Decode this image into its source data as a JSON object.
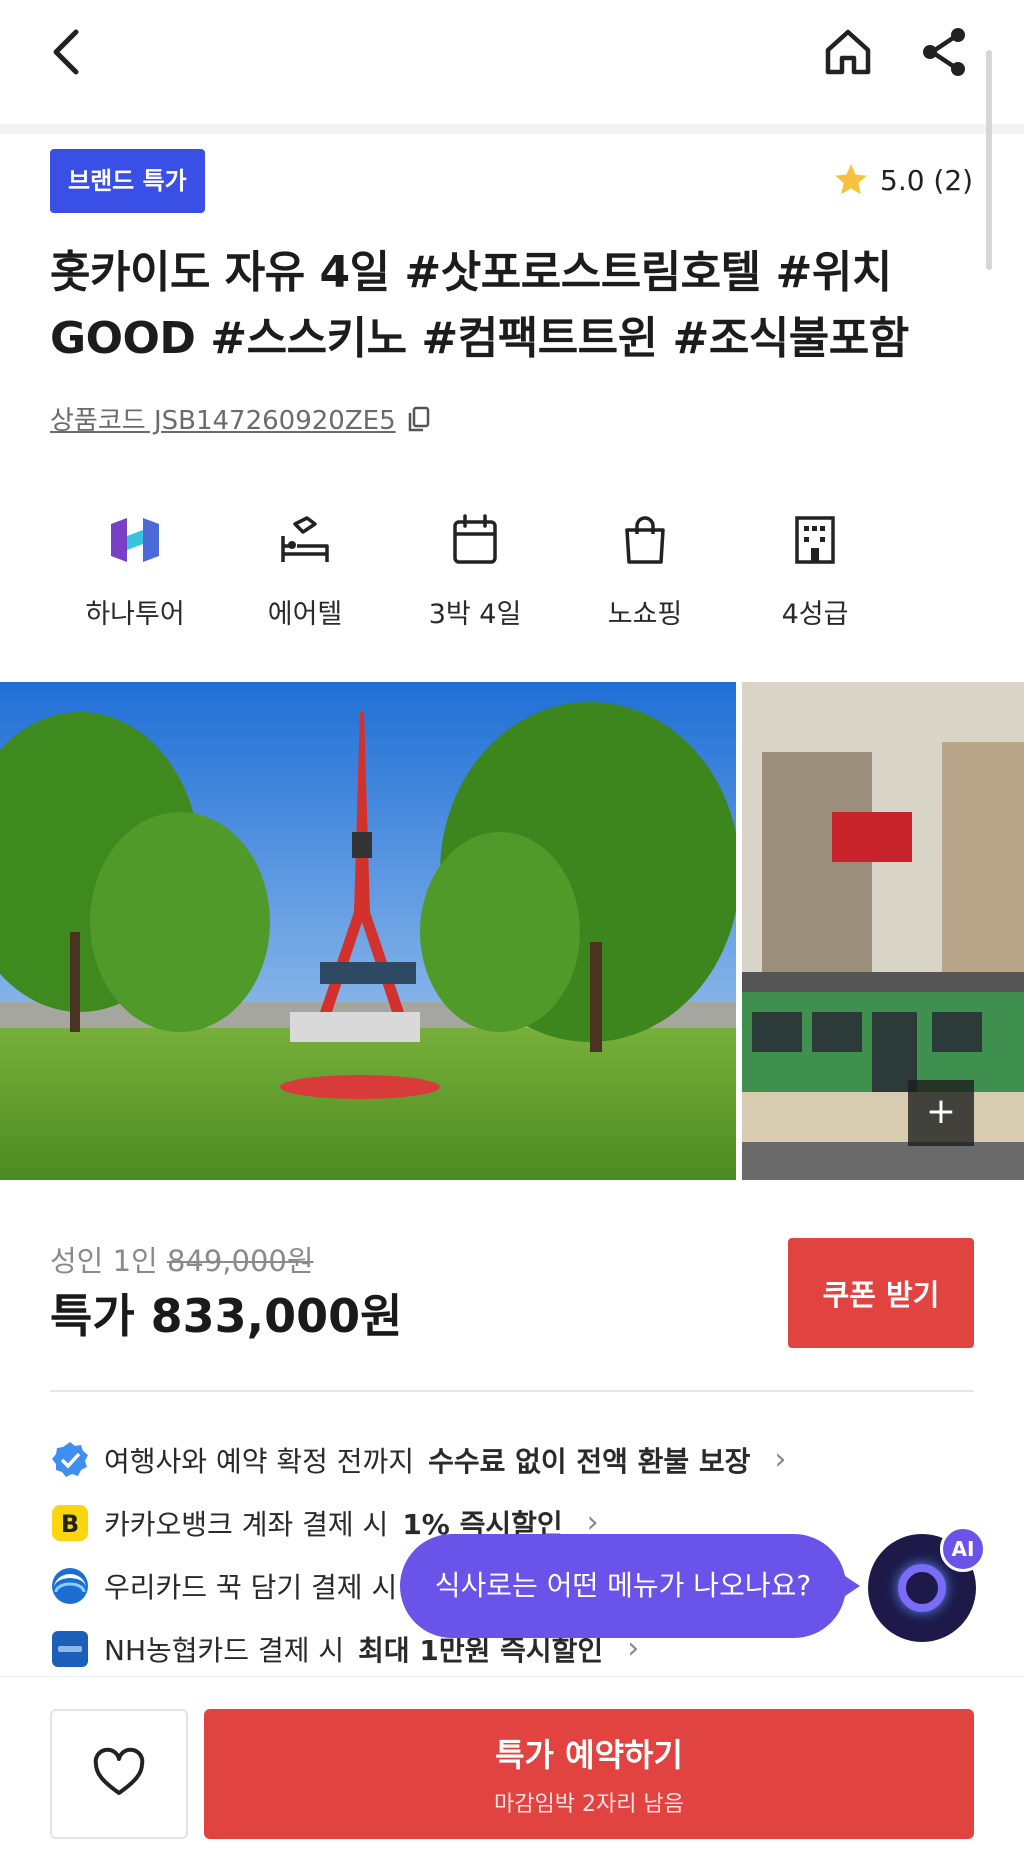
{
  "header": {
    "back_icon": "chevron-left-icon",
    "home_icon": "home-icon",
    "share_icon": "share-icon"
  },
  "product": {
    "badge": "브랜드 특가",
    "rating": "5.0 (2)",
    "title": "홋카이도 자유 4일 #삿포로스트림호텔 #위치 GOOD #스스키노 #컴팩트트윈 #조식불포함",
    "code": "상품코드 JSB147260920ZE5"
  },
  "features": [
    {
      "label": "하나투어",
      "icon": "hanatour-logo-icon"
    },
    {
      "label": "에어텔",
      "icon": "plane-bed-icon"
    },
    {
      "label": "3박 4일",
      "icon": "calendar-icon"
    },
    {
      "label": "노쇼핑",
      "icon": "shopping-bag-icon"
    },
    {
      "label": "4성급",
      "icon": "building-icon"
    }
  ],
  "price": {
    "adult_label": "성인 1인",
    "original": "849,000원",
    "special": "특가 833,000원",
    "coupon_button": "쿠폰 받기"
  },
  "benefits": [
    {
      "text": "여행사와 예약 확정 전까지 ",
      "bold": "수수료 없이 전액 환불 보장",
      "icon": "verified-badge-icon"
    },
    {
      "text": "카카오뱅크 계좌 결제 시 ",
      "bold": "1% 즉시할인",
      "icon": "kakaobank-icon"
    },
    {
      "text": "우리카드 꾹 담기 결제 시",
      "bold": "",
      "icon": "wooricard-icon"
    },
    {
      "text": "NH농협카드 결제 시 ",
      "bold": "최대 1만원 즉시할인",
      "icon": "nhcard-icon"
    }
  ],
  "ai": {
    "bubble": "식사로는 어떤 메뉴가 나오나요?",
    "tag": "AI"
  },
  "gallery": {
    "more": "+"
  },
  "bottom": {
    "book_main": "특가 예약하기",
    "book_sub": "마감임박 2자리 남음"
  },
  "colors": {
    "brand_blue": "#3a4fe6",
    "accent_red": "#e14341",
    "ai_purple": "#6a53e8"
  }
}
